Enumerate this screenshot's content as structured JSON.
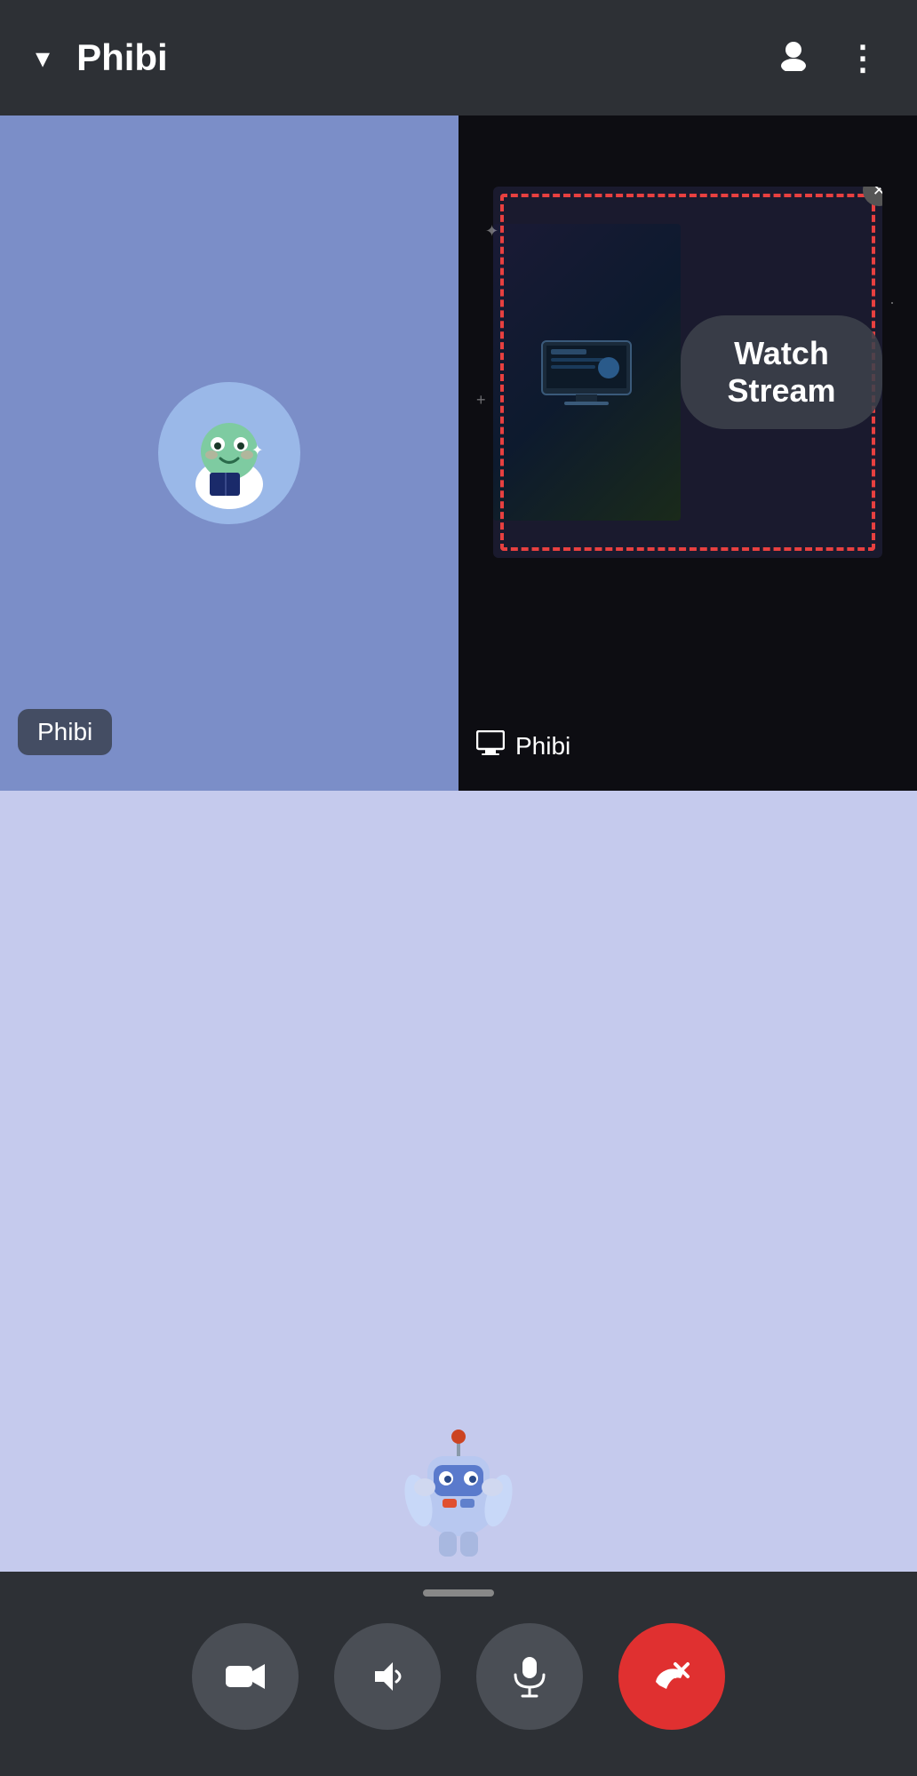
{
  "header": {
    "title": "Phibi",
    "chevron_label": "▾",
    "profile_icon": "👤",
    "menu_icon": "⋮"
  },
  "video_grid": {
    "left_panel": {
      "name_badge": "Phibi"
    },
    "right_panel": {
      "watch_stream_label": "Watch Stream",
      "name_badge": "Phibi",
      "close_label": "✕"
    }
  },
  "toolbar": {
    "handle_label": "",
    "camera_label": "🎥",
    "speaker_label": "🔊",
    "mic_label": "🎤",
    "end_call_label": "📞"
  }
}
